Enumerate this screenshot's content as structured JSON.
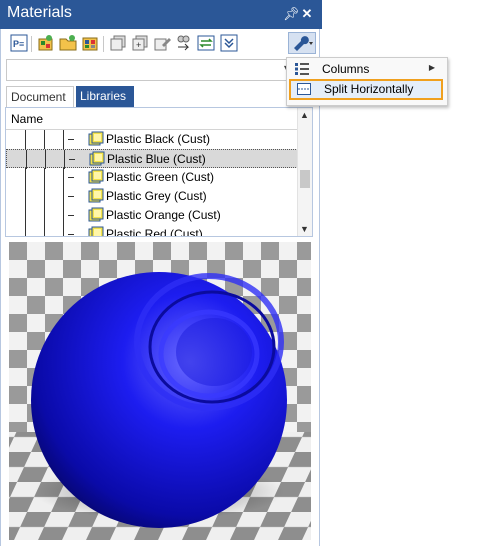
{
  "window": {
    "title": "Materials",
    "pin_icon": "pin-icon",
    "close_icon": "close-icon",
    "accent": "#2b5797"
  },
  "toolbar": {
    "icons": [
      "properties-icon",
      "new-material-icon",
      "open-library-icon",
      "import-icon",
      "copy-icon",
      "duplicate-icon",
      "edit-icon",
      "assign-icon",
      "swap-icon",
      "collapse-icon",
      "tools-icon"
    ]
  },
  "combo": {
    "value": ""
  },
  "tabs": [
    {
      "label": "Document",
      "active": false
    },
    {
      "label": "Libraries",
      "active": true
    }
  ],
  "tree": {
    "header": "Name",
    "rows": [
      {
        "label": "Plastic Black (Cust)",
        "selected": false
      },
      {
        "label": "Plastic Blue (Cust)",
        "selected": true
      },
      {
        "label": "Plastic Green (Cust)",
        "selected": false
      },
      {
        "label": "Plastic Grey (Cust)",
        "selected": false
      },
      {
        "label": "Plastic Orange (Cust)",
        "selected": false
      },
      {
        "label": "Plastic Red (Cust)",
        "selected": false
      }
    ]
  },
  "preview": {
    "material_color": "#1515e0",
    "description": "material sphere preview"
  },
  "context_menu": {
    "items": [
      {
        "label": "Columns",
        "icon": "columns-icon",
        "has_submenu": true
      },
      {
        "label": "Split Horizontally",
        "icon": "split-icon",
        "highlighted": true
      }
    ],
    "highlight_color": "#f0a01e"
  }
}
